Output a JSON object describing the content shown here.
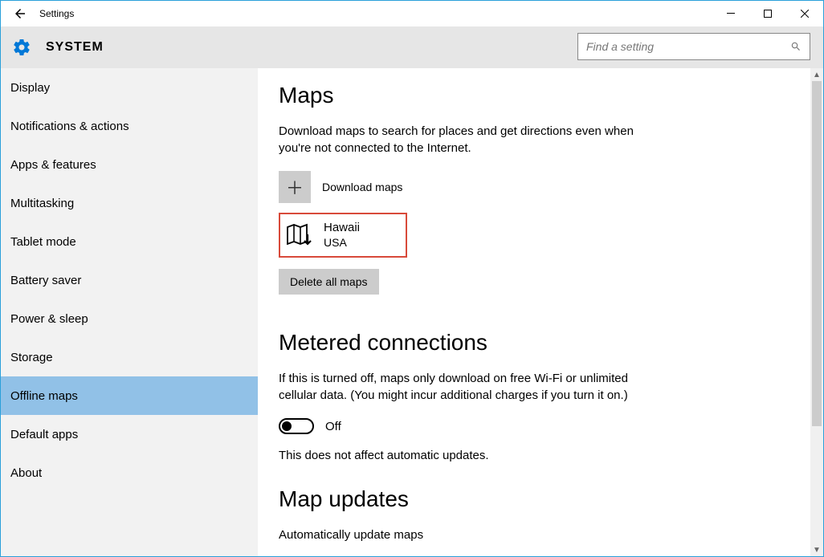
{
  "window": {
    "title": "Settings"
  },
  "header": {
    "title": "SYSTEM",
    "search_placeholder": "Find a setting"
  },
  "sidebar": {
    "items": [
      {
        "label": "Display",
        "selected": false
      },
      {
        "label": "Notifications & actions",
        "selected": false
      },
      {
        "label": "Apps & features",
        "selected": false
      },
      {
        "label": "Multitasking",
        "selected": false
      },
      {
        "label": "Tablet mode",
        "selected": false
      },
      {
        "label": "Battery saver",
        "selected": false
      },
      {
        "label": "Power & sleep",
        "selected": false
      },
      {
        "label": "Storage",
        "selected": false
      },
      {
        "label": "Offline maps",
        "selected": true
      },
      {
        "label": "Default apps",
        "selected": false
      },
      {
        "label": "About",
        "selected": false
      }
    ]
  },
  "content": {
    "maps": {
      "heading": "Maps",
      "description": "Download maps to search for places and get directions even when you're not connected to the Internet.",
      "download_label": "Download maps",
      "items": [
        {
          "name": "Hawaii",
          "sub": "USA"
        }
      ],
      "delete_label": "Delete all maps"
    },
    "metered": {
      "heading": "Metered connections",
      "description": "If this is turned off, maps only download on free Wi-Fi or unlimited cellular data. (You might incur additional charges if you turn it on.)",
      "toggle_state": "Off",
      "note": "This does not affect automatic updates."
    },
    "updates": {
      "heading": "Map updates",
      "auto_label": "Automatically update maps"
    }
  }
}
